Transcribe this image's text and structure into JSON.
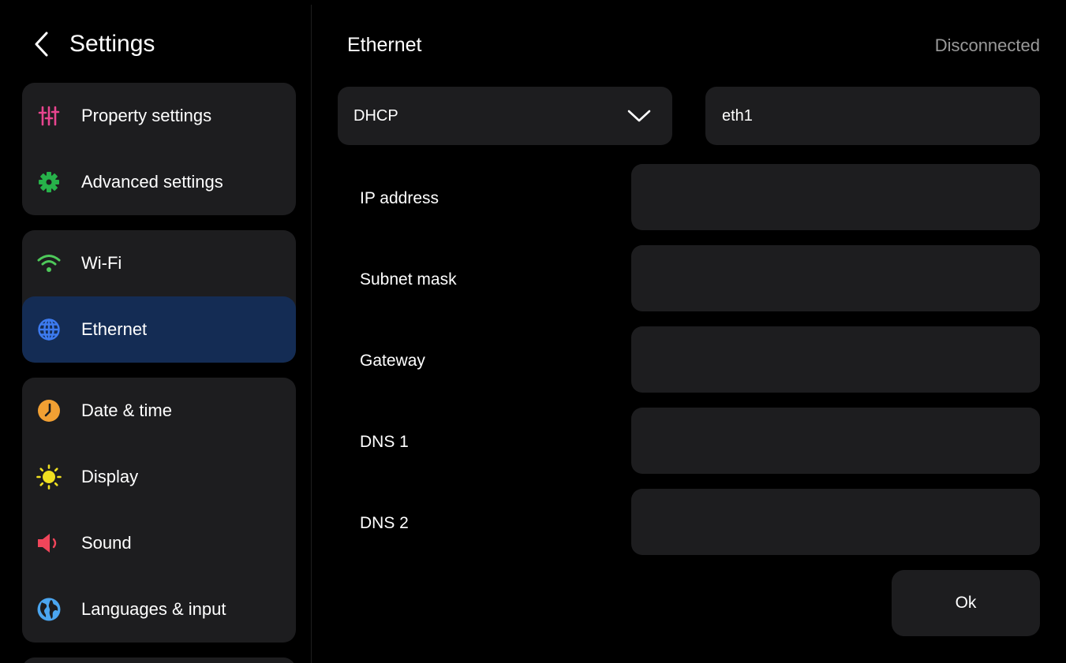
{
  "sidebar": {
    "title": "Settings",
    "items": [
      {
        "label": "Property settings",
        "icon": "sliders-icon",
        "color": "#e8458f"
      },
      {
        "label": "Advanced settings",
        "icon": "gear-icon",
        "color": "#27b24a"
      },
      {
        "label": "Wi-Fi",
        "icon": "wifi-icon",
        "color": "#4ec95a"
      },
      {
        "label": "Ethernet",
        "icon": "globe-icon",
        "color": "#3d7bf0",
        "active": true
      },
      {
        "label": "Date & time",
        "icon": "clock-icon",
        "color": "#f2a033"
      },
      {
        "label": "Display",
        "icon": "sun-icon",
        "color": "#f0e020"
      },
      {
        "label": "Sound",
        "icon": "speaker-icon",
        "color": "#f0455a"
      },
      {
        "label": "Languages & input",
        "icon": "earth-icon",
        "color": "#4ba6f0"
      }
    ]
  },
  "main": {
    "title": "Ethernet",
    "status": "Disconnected",
    "mode": {
      "value": "DHCP"
    },
    "interface": {
      "value": "eth1"
    },
    "fields": [
      {
        "label": "IP address",
        "value": ""
      },
      {
        "label": "Subnet mask",
        "value": ""
      },
      {
        "label": "Gateway",
        "value": ""
      },
      {
        "label": "DNS 1",
        "value": ""
      },
      {
        "label": "DNS 2",
        "value": ""
      }
    ],
    "ok_label": "Ok"
  },
  "colors": {
    "background": "#000000",
    "card": "#1d1d1f",
    "active_item": "#142c54",
    "muted_text": "#9a9a9a"
  }
}
